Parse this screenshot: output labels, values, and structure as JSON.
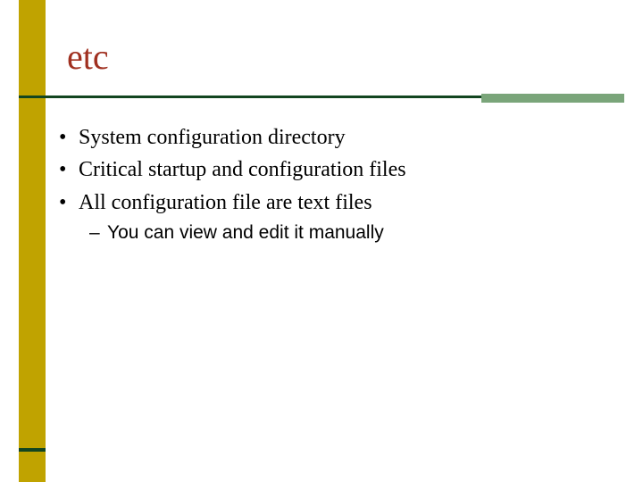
{
  "colors": {
    "mustard": "#c0a300",
    "rule_dark": "#124520",
    "rule_accent": "#7aa57a",
    "title": "#a03020"
  },
  "title": "etc",
  "bullets": [
    {
      "text": "System configuration directory"
    },
    {
      "text": "Critical startup and configuration files"
    },
    {
      "text": "All configuration file are text files",
      "sub": [
        {
          "text": "You can view and edit it manually"
        }
      ]
    }
  ]
}
